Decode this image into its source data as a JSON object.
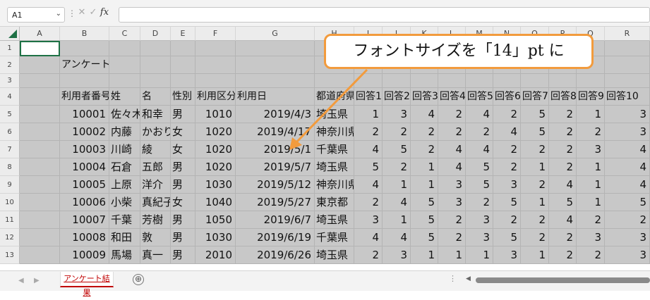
{
  "namebox": {
    "value": "A1",
    "chevron": "⌄"
  },
  "formula_bar": {
    "more_icon": "⋮",
    "cancel_icon": "✕",
    "enter_icon": "✓",
    "fx_label": "fx",
    "value": ""
  },
  "columns": [
    "A",
    "B",
    "C",
    "D",
    "E",
    "F",
    "G",
    "H",
    "I",
    "J",
    "K",
    "L",
    "M",
    "N",
    "O",
    "P",
    "Q",
    "R"
  ],
  "rows": [
    "1",
    "2",
    "3",
    "4",
    "5",
    "6",
    "7",
    "8",
    "9",
    "10",
    "11",
    "12",
    "13"
  ],
  "title_cell": "アンケート",
  "headers": [
    "利用者番号",
    "姓",
    "名",
    "性別",
    "利用区分",
    "利用日",
    "都道府県",
    "回答1",
    "回答2",
    "回答3",
    "回答4",
    "回答5",
    "回答6",
    "回答7",
    "回答8",
    "回答9",
    "回答10"
  ],
  "records": [
    [
      "10001",
      "佐々木",
      "和幸",
      "男",
      "1010",
      "2019/4/3",
      "埼玉県",
      "1",
      "3",
      "4",
      "2",
      "4",
      "2",
      "5",
      "2",
      "1",
      "3"
    ],
    [
      "10002",
      "内藤",
      "かおり",
      "女",
      "1020",
      "2019/4/17",
      "神奈川県",
      "2",
      "2",
      "2",
      "2",
      "2",
      "4",
      "5",
      "2",
      "2",
      "3"
    ],
    [
      "10003",
      "川崎",
      "綾",
      "女",
      "1020",
      "2019/5/1",
      "千葉県",
      "4",
      "5",
      "2",
      "4",
      "4",
      "2",
      "2",
      "2",
      "3",
      "4"
    ],
    [
      "10004",
      "石倉",
      "五郎",
      "男",
      "1020",
      "2019/5/7",
      "埼玉県",
      "5",
      "2",
      "1",
      "4",
      "5",
      "2",
      "1",
      "2",
      "1",
      "4"
    ],
    [
      "10005",
      "上原",
      "洋介",
      "男",
      "1030",
      "2019/5/12",
      "神奈川県",
      "4",
      "1",
      "1",
      "3",
      "5",
      "3",
      "2",
      "4",
      "1",
      "4"
    ],
    [
      "10006",
      "小柴",
      "真紀子",
      "女",
      "1040",
      "2019/5/27",
      "東京都",
      "2",
      "4",
      "5",
      "3",
      "2",
      "5",
      "1",
      "5",
      "1",
      "5"
    ],
    [
      "10007",
      "千葉",
      "芳樹",
      "男",
      "1050",
      "2019/6/7",
      "埼玉県",
      "3",
      "1",
      "5",
      "2",
      "3",
      "2",
      "2",
      "4",
      "2",
      "2"
    ],
    [
      "10008",
      "和田",
      "敦",
      "男",
      "1030",
      "2019/6/19",
      "千葉県",
      "4",
      "4",
      "5",
      "2",
      "3",
      "5",
      "2",
      "2",
      "3",
      "3"
    ],
    [
      "10009",
      "馬場",
      "真一",
      "男",
      "2010",
      "2019/6/26",
      "埼玉県",
      "2",
      "3",
      "1",
      "1",
      "1",
      "3",
      "1",
      "2",
      "2",
      "3"
    ]
  ],
  "callout": "フォントサイズを「14」pt に",
  "sheet_tab": "アンケート結果",
  "add_sheet": "⊕",
  "colors": {
    "callout_border": "#f29b3d",
    "tab_red": "#c00000",
    "selection_green": "#1e7145"
  }
}
